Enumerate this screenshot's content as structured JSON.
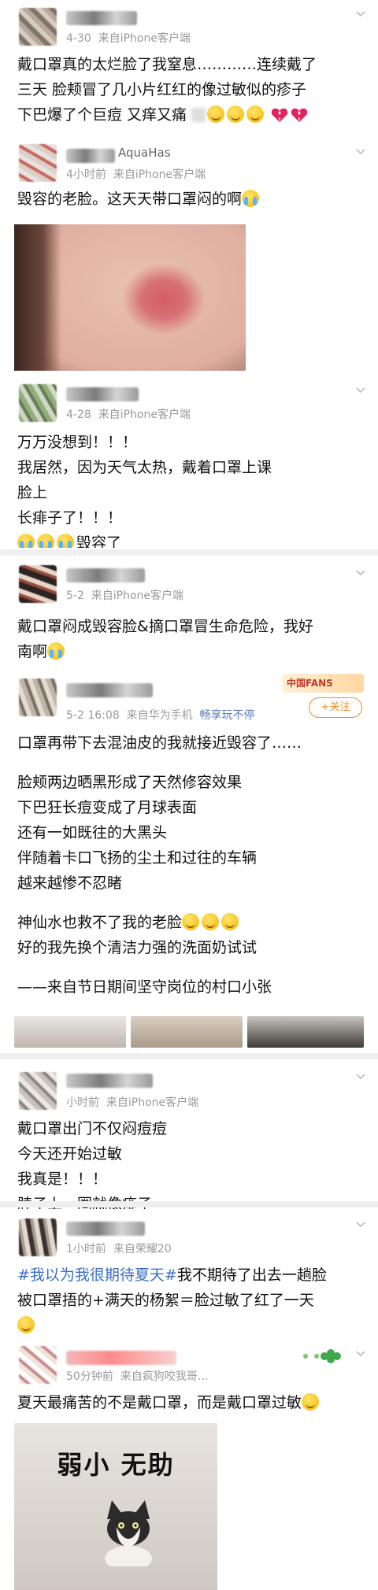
{
  "posts": [
    {
      "time": "4-30",
      "source": "来自iPhone客户端",
      "lines": [
        "戴口罩真的太烂脸了我窒息…………连续戴了",
        "三天 脸颊冒了几小片红红的像过敏似的疹子",
        "下巴爆了个巨痘 又痒又痛"
      ]
    },
    {
      "nick": "AquaHas",
      "time": "4小时前",
      "source": "来自iPhone客户端",
      "lines": [
        "毁容的老脸。这天天带口罩闷的啊"
      ]
    },
    {
      "time": "4-28",
      "source": "来自iPhone客户端",
      "lines": [
        "万万没想到！！！",
        "我居然，因为天气太热，戴着口罩上课",
        "脸上",
        "长痱子了！！！",
        "毁容了"
      ]
    },
    {
      "time": "5-2",
      "source": "来自iPhone客户端",
      "lines": [
        "戴口罩闷成毁容脸&摘口罩冒生命危险，我好",
        "南啊"
      ]
    },
    {
      "time": "5-2 16:08",
      "source": "来自华为手机",
      "link": "畅享玩不停",
      "follow": "+关注",
      "badge": "中国FANS",
      "lines": [
        "口罩再带下去混油皮的我就接近毁容了……",
        "",
        "脸颊两边晒黑形成了天然修容效果",
        "下巴狂长痘变成了月球表面",
        "还有一如既往的大黑头",
        "伴随着卡口飞扬的尘土和过往的车辆",
        "越来越惨不忍睹",
        "",
        "神仙水也救不了我的老脸",
        "好的我先换个清洁力强的洗面奶试试",
        "",
        "——来自节日期间坚守岗位的村口小张"
      ]
    },
    {
      "time": "小时前",
      "source": "来自iPhone客户端",
      "lines": [
        "戴口罩出门不仅闷痘痘",
        "今天还开始过敏",
        "我真是！！！",
        "脖子上一圈就像痱子"
      ]
    },
    {
      "time": "1小时前",
      "source": "来自荣耀20",
      "hashtag": "#我以为我很期待夏天#",
      "lines": [
        "我不期待了出去一趟脸",
        "被口罩捂的+满天的杨絮＝脸过敏了红了一天"
      ]
    },
    {
      "time": "50分钟前",
      "source": "来自疯狗咬我哥…",
      "lines": [
        "夏天最痛苦的不是戴口罩，而是戴口罩过敏"
      ],
      "meme_caption": "弱小 无助"
    }
  ],
  "colors": {
    "link": "#5b7dbb",
    "hashtag": "#3a6fc8",
    "follow": "#f08a2a",
    "meta": "#9a9a9a",
    "separator": "#efefef"
  }
}
